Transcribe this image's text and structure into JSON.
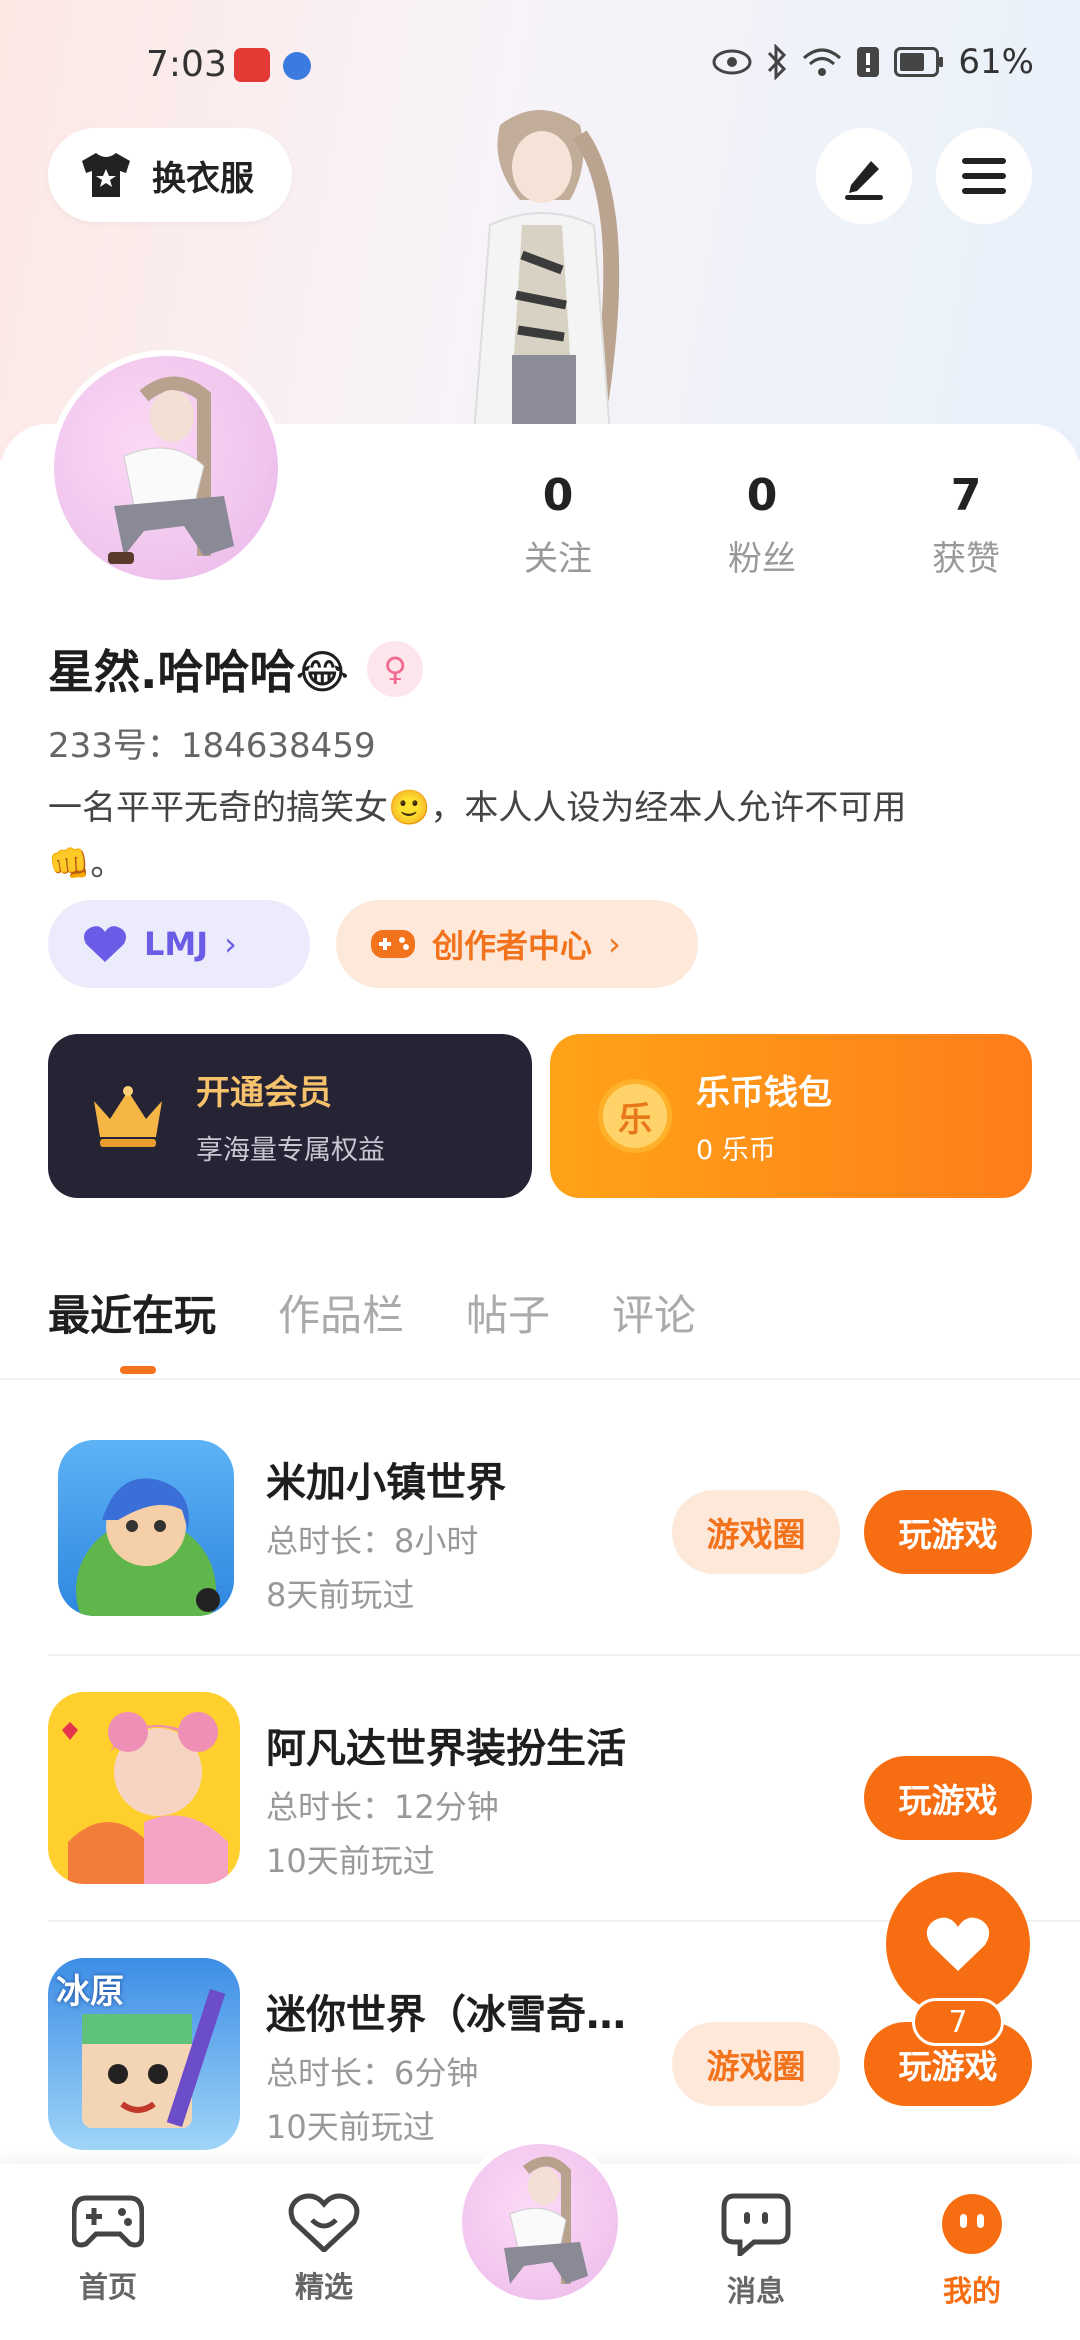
{
  "status_bar": {
    "time": "7:03",
    "battery": "61%"
  },
  "header": {
    "outfit_label": "换衣服"
  },
  "profile": {
    "name": "星然.哈哈哈😂",
    "gender_icon": "♀",
    "uid": "233号：184638459",
    "bio_line1": "一名平平无奇的搞笑女🙂，本人人设为经本人允许不可用",
    "bio_line2": "👊。",
    "stats": [
      {
        "value": "0",
        "label": "关注"
      },
      {
        "value": "0",
        "label": "粉丝"
      },
      {
        "value": "7",
        "label": "获赞"
      }
    ],
    "pills": {
      "lmj": "LMJ",
      "creator": "创作者中心"
    }
  },
  "cards": {
    "vip": {
      "title": "开通会员",
      "subtitle": "享海量专属权益"
    },
    "wallet": {
      "title": "乐币钱包",
      "subtitle": "0 乐币",
      "coin_char": "乐"
    }
  },
  "tabs": [
    {
      "label": "最近在玩",
      "active": true
    },
    {
      "label": "作品栏",
      "active": false
    },
    {
      "label": "帖子",
      "active": false
    },
    {
      "label": "评论",
      "active": false
    }
  ],
  "games": [
    {
      "name": "米加小镇世界",
      "duration": "总时长：8小时",
      "last": "8天前玩过",
      "circle_btn": "游戏圈",
      "play_btn": "玩游戏"
    },
    {
      "name": "阿凡达世界装扮生活",
      "duration": "总时长：12分钟",
      "last": "10天前玩过",
      "circle_btn": "",
      "play_btn": "玩游戏"
    },
    {
      "name": "迷你世界（冰雪奇…",
      "duration": "总时长：6分钟",
      "last": "10天前玩过",
      "circle_btn": "游戏圈",
      "play_btn": "玩游戏",
      "icon_text": "冰原"
    }
  ],
  "fab": {
    "badge": "7"
  },
  "bottom_nav": [
    {
      "label": "首页",
      "icon": "gamepad-icon"
    },
    {
      "label": "精选",
      "icon": "heart-chat-icon"
    },
    {
      "label": "消息",
      "icon": "message-icon"
    },
    {
      "label": "我的",
      "icon": "profile-face-icon"
    }
  ],
  "colors": {
    "accent": "#f76d12",
    "vip_bg": "#262335",
    "lmj_purple": "#6a5ce6"
  }
}
